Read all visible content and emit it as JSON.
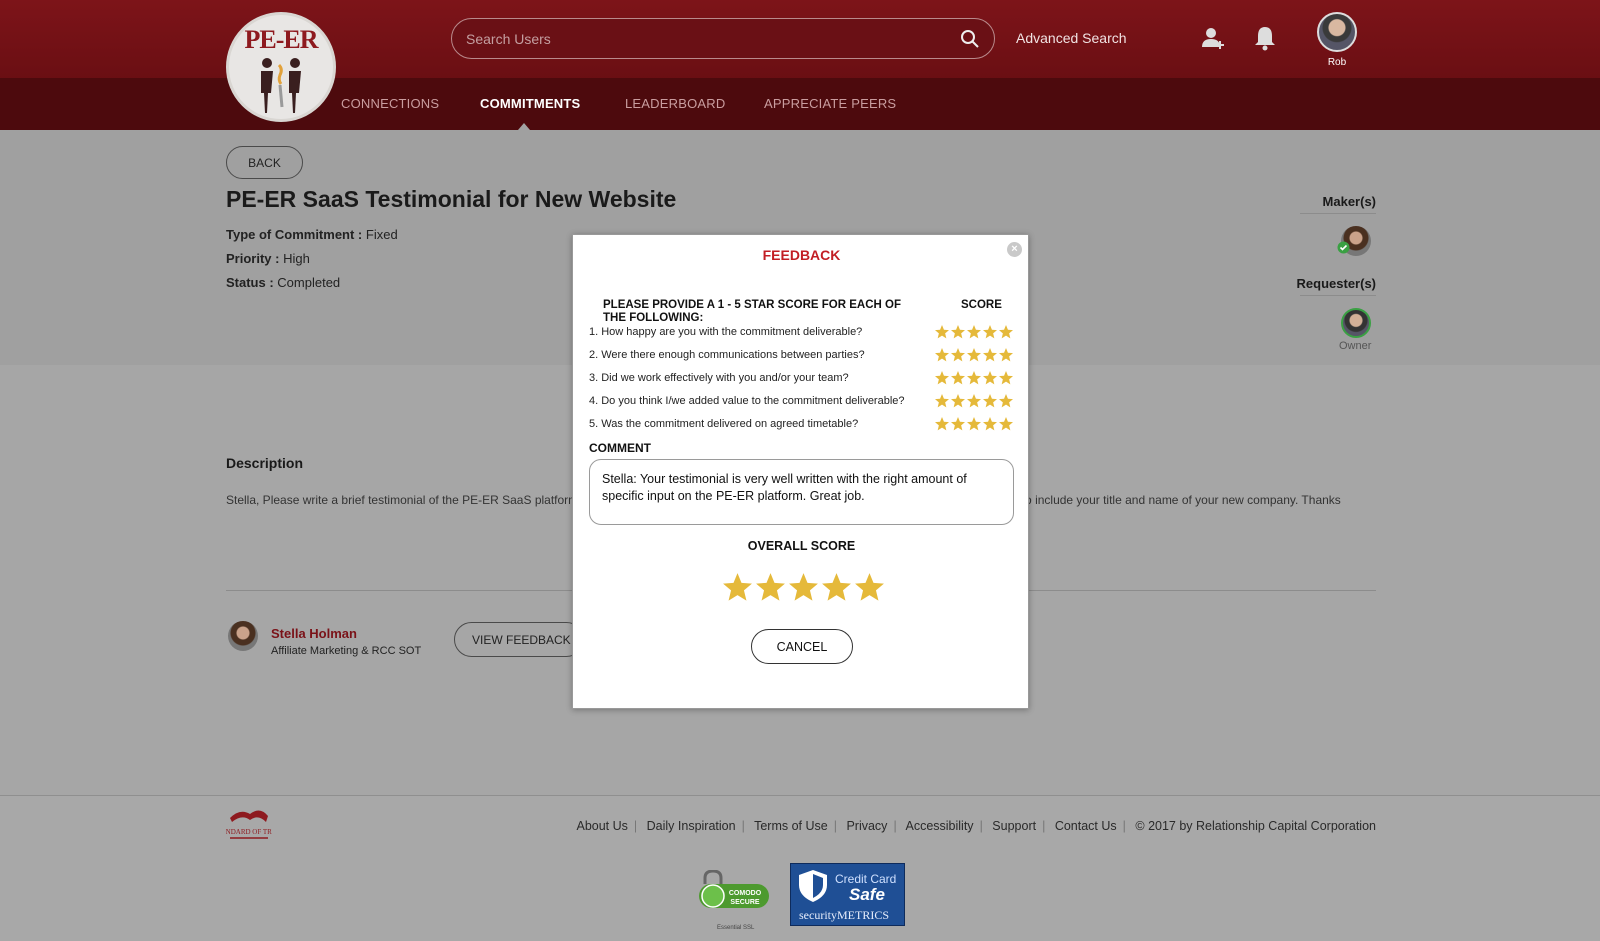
{
  "header": {
    "logo_text": "PE-ER",
    "search_placeholder": "Search Users",
    "advanced_search": "Advanced Search",
    "user_name": "Rob",
    "nav": [
      {
        "label": "CONNECTIONS",
        "active": false
      },
      {
        "label": "COMMITMENTS",
        "active": true
      },
      {
        "label": "LEADERBOARD",
        "active": false
      },
      {
        "label": "APPRECIATE PEERS",
        "active": false
      }
    ]
  },
  "commitment": {
    "back_label": "BACK",
    "title": "PE-ER SaaS Testimonial for New Website",
    "type_label": "Type of Commitment :",
    "type_value": "Fixed",
    "priority_label": "Priority :",
    "priority_value": "High",
    "status_label": "Status :",
    "status_value": "Completed",
    "makers_label": "Maker(s)",
    "requesters_label": "Requester(s)",
    "requester_role": "Owner",
    "description_heading": "Description",
    "description_text": "Stella, Please write a brief testimonial of the PE-ER SaaS platform and what it means to you and your company as a member of the platform. Be sure to include your title and name of your new company. Thanks",
    "maker_name": "Stella Holman",
    "maker_role": "Affiliate Marketing & RCC SOT",
    "view_feedback_label": "VIEW FEEDBACK"
  },
  "modal": {
    "title": "FEEDBACK",
    "instruction": "PLEASE PROVIDE A 1 - 5 STAR SCORE FOR EACH OF THE FOLLOWING:",
    "score_heading": "SCORE",
    "questions": [
      {
        "text": "1. How happy are you with the commitment deliverable?",
        "score": 5
      },
      {
        "text": "2. Were there enough communications between parties?",
        "score": 5
      },
      {
        "text": "3. Did we work effectively with you and/or your team?",
        "score": 5
      },
      {
        "text": "4. Do you think I/we added value to the commitment deliverable?",
        "score": 5
      },
      {
        "text": "5. Was the commitment delivered on agreed timetable?",
        "score": 5
      }
    ],
    "comment_heading": "COMMENT",
    "comment_text": "Stella: Your testimonial is very well written with the right amount of specific input on the PE-ER platform. Great job.",
    "overall_heading": "OVERALL SCORE",
    "overall_score": 5,
    "cancel_label": "CANCEL"
  },
  "footer": {
    "trust_logo_text": "STANDARD OF TRUST",
    "links": [
      "About Us",
      "Daily Inspiration",
      "Terms of Use",
      "Privacy",
      "Accessibility",
      "Support",
      "Contact Us"
    ],
    "copyright": "© 2017 by Relationship Capital Corporation",
    "comodo_line1": "COMODO",
    "comodo_line2": "SECURE",
    "comodo_sub": "Essential SSL",
    "ccsafe_line1": "Credit Card",
    "ccsafe_line2": "Safe",
    "ccsafe_line3": "securityMETRICS"
  },
  "colors": {
    "brand_dark_red": "#5e0b0f",
    "accent_red": "#c21e24",
    "star_gold": "#e5b93a"
  }
}
